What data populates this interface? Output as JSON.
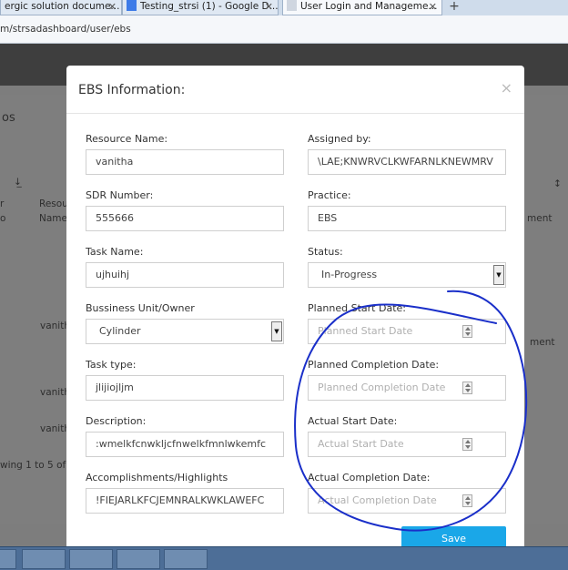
{
  "browser": {
    "tabs": [
      {
        "title": "ergic solution docume..."
      },
      {
        "title": "Testing_strsi (1) - Google D..."
      },
      {
        "title": "User Login and Manageme..."
      }
    ],
    "new_tab": "+",
    "url": "m/strsadashboard/user/ebs"
  },
  "background": {
    "section": "os",
    "col_resource": "Resou",
    "col_name": "Name",
    "col_r": "r",
    "col_o": "o",
    "col_ment": "ment",
    "row_names": [
      "vanith",
      "vanith",
      "vanith"
    ],
    "row_ment": "ment",
    "pagination": "wing 1 to 5 of 5"
  },
  "modal": {
    "title": "EBS Information:",
    "close": "×",
    "left": {
      "resource_label": "Resource Name:",
      "resource_value": "vanitha",
      "sdr_label": "SDR Number:",
      "sdr_value": "555666",
      "task_label": "Task Name:",
      "task_value": "ujhuihj",
      "bu_label": "Bussiness Unit/Owner",
      "bu_value": "Cylinder",
      "tasktype_label": "Task type:",
      "tasktype_value": "jlijiojljm",
      "desc_label": "Description:",
      "desc_value": ":wmelkfcnwkljcfnwelkfmnlwkemfc",
      "acc_label": "Accomplishments/Highlights",
      "acc_value": "!FIEJARLKFCJEMNRALKWKLAWEFC"
    },
    "right": {
      "assigned_label": "Assigned by:",
      "assigned_value": "\\LAE;KNWRVCLKWFARNLKNEWMRV",
      "practice_label": "Practice:",
      "practice_value": "EBS",
      "status_label": "Status:",
      "status_value": "In-Progress",
      "pstart_label": "Planned Start Date:",
      "pstart_placeholder": "Planned Start Date",
      "pcomp_label": "Planned Completion Date:",
      "pcomp_placeholder": "Planned Completion Date",
      "astart_label": "Actual Start Date:",
      "astart_placeholder": "Actual Start Date",
      "acomp_label": "Actual Completion Date:",
      "acomp_placeholder": "Actual Completion Date"
    },
    "save_label": "Save"
  },
  "colors": {
    "accent": "#1aa7e8",
    "annotation": "#1a2fc9"
  }
}
